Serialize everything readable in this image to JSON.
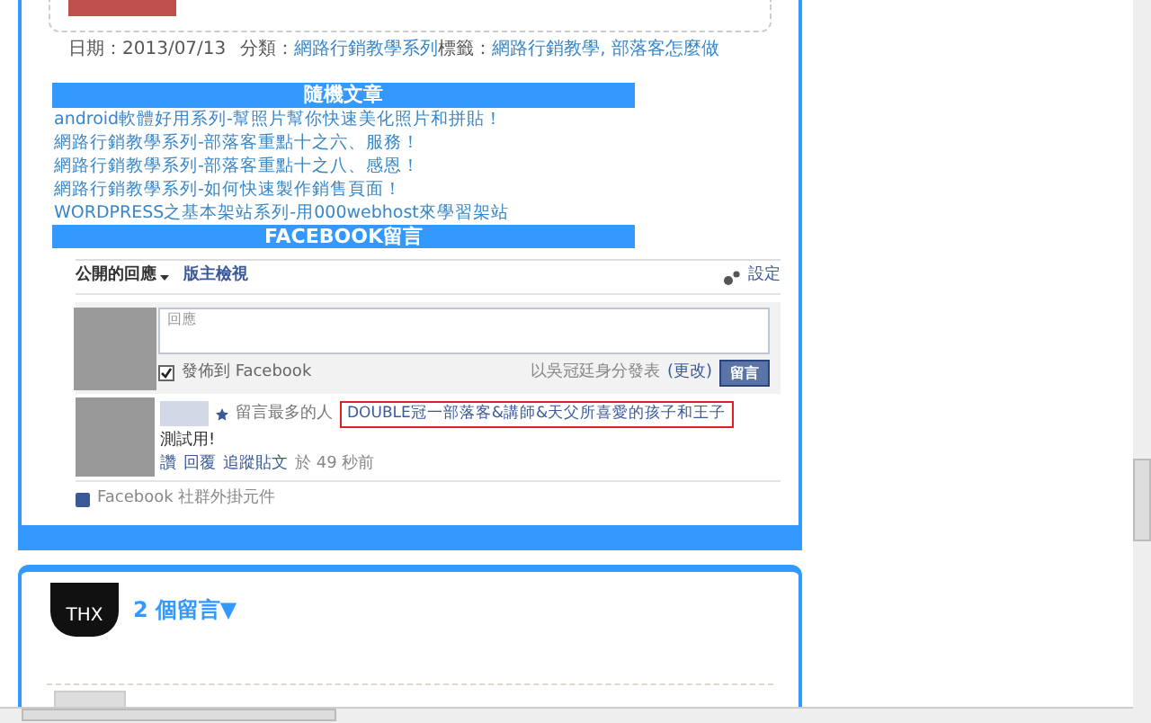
{
  "post_meta": {
    "date_label": "日期：2013/07/13",
    "category_label": "分類：",
    "category": "網路行銷教學系列",
    "tags_label": "標籤：",
    "tags": "網路行銷教學, 部落客怎麼做"
  },
  "random_posts": {
    "title": "隨機文章",
    "links": [
      "android軟體好用系列-幫照片幫你快速美化照片和拼貼！",
      "網路行銷教學系列-部落客重點十之六、服務！",
      "網路行銷教學系列-部落客重點十之八、感恩！",
      "網路行銷教學系列-如何快速製作銷售頁面！",
      "WORDPRESS之基本架站系列-用000webhost來學習架站"
    ]
  },
  "facebook_comments": {
    "title": "FACEBOOK留言",
    "tabs": [
      {
        "label": "公開的回應",
        "selected": true
      },
      {
        "label": "版主檢視",
        "selected": false
      }
    ],
    "settings": "設定",
    "compose": {
      "placeholder": "回應",
      "post_to_facebook": {
        "label": "發佈到 Facebook",
        "checked": true
      },
      "posting_as": "以吳冠廷身分發表",
      "change": "(更改)",
      "submit": "留言"
    },
    "comments": [
      {
        "badge": "留言最多的人",
        "title": "DOUBLE冠一部落客&講師&天父所喜愛的孩子和王子",
        "highlighted": true,
        "body": "測試用!",
        "actions": [
          "讚",
          "回覆",
          "追蹤貼文"
        ],
        "time": "於 49 秒前"
      }
    ],
    "footer": "Facebook 社群外掛元件"
  },
  "comments_section": {
    "logo_text": "THX",
    "count": "2",
    "label": "個留言▼"
  }
}
